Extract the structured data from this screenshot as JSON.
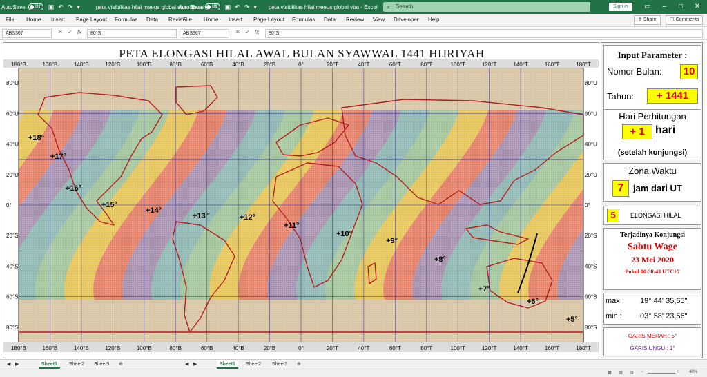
{
  "window": {
    "autosave_label": "AutoSave",
    "autosave_state": "Off",
    "title": "peta visibilitas hilal meeus global vba  -  Excel",
    "search_placeholder": "Search",
    "signin_label": "Sign in"
  },
  "ribbon": {
    "tabs_left": [
      "File",
      "Home",
      "Insert",
      "Page Layout",
      "Formulas",
      "Data",
      "Review"
    ],
    "tabs_right": [
      "File",
      "Home",
      "Insert",
      "Page Layout",
      "Formulas",
      "Data",
      "Review",
      "View",
      "Developer",
      "Help"
    ],
    "share_label": "Share",
    "comments_label": "Comments"
  },
  "formula_bar": {
    "name_box": "ABS367",
    "value": "80°S"
  },
  "map": {
    "title": "PETA ELONGASI HILAL AWAL BULAN SYAWWAL 1441 HIJRIYAH",
    "lon_labels": [
      "180°B",
      "160°B",
      "140°B",
      "120°B",
      "100°B",
      "80°B",
      "60°B",
      "40°B",
      "20°B",
      "0°",
      "20°T",
      "40°T",
      "60°T",
      "80°T",
      "100°T",
      "120°T",
      "140°T",
      "160°T",
      "180°T"
    ],
    "lat_labels": [
      "80°U",
      "60°U",
      "40°U",
      "20°U",
      "0°",
      "20°S",
      "40°S",
      "60°S",
      "80°S"
    ],
    "elongation_labels": [
      "+18°",
      "+17°",
      "+16°",
      "+15°",
      "+14°",
      "+13°",
      "+12°",
      "+11°",
      "+10°",
      "+9°",
      "+8°",
      "+7°",
      "+6°",
      "+5°"
    ],
    "band_colors": [
      "#e8c85c",
      "#e8836a",
      "#a893b2",
      "#8fb9b4",
      "#a4c79f"
    ],
    "land_color": "#b51e1e"
  },
  "panel": {
    "input_header": "Input Parameter :",
    "nomor_bulan_label": "Nomor Bulan:",
    "nomor_bulan_value": "10",
    "tahun_label": "Tahun:",
    "tahun_value": "+  1441",
    "hari_header": "Hari Perhitungan",
    "hari_value": "+  1",
    "hari_unit": "hari",
    "hari_note": "(setelah konjungsi)",
    "zona_header": "Zona Waktu",
    "zona_value": "7",
    "zona_unit": "jam dari UT",
    "elong_value": "5",
    "elong_label": "ELONGASI HILAL",
    "konj_header": "Terjadinya Konjungsi",
    "konj_day": "Sabtu Wage",
    "konj_date": "23 Mei 2020",
    "konj_time": "Pukul 00:38:43 UTC+7",
    "max_label": "max :",
    "max_value": "19° 44' 35,65\"",
    "min_label": "min :",
    "min_value": "03° 58' 23,56\"",
    "garis_merah": "GARIS MERAH : 5°",
    "garis_ungu": "GARIS UNGU : 1°"
  },
  "sheets": {
    "left": [
      "Sheet1",
      "Sheet2",
      "Sheet3"
    ],
    "right": [
      "Sheet1",
      "Sheet2",
      "Sheet3"
    ]
  },
  "status": {
    "zoom": "40%"
  }
}
